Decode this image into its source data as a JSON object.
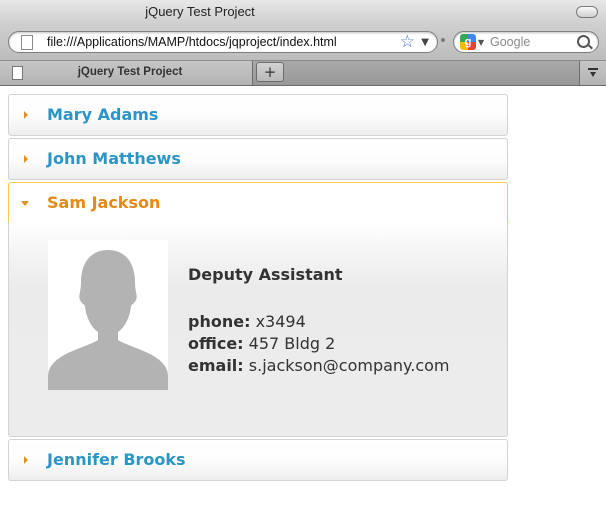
{
  "window": {
    "title": "jQuery Test Project"
  },
  "toolbar": {
    "url": "file:///Applications/MAMP/htdocs/jqproject/index.html",
    "search_placeholder": "Google"
  },
  "tabs": [
    {
      "title": "jQuery Test Project"
    }
  ],
  "new_tab_label": "+",
  "accordion": {
    "items": [
      {
        "name": "Mary Adams",
        "expanded": false
      },
      {
        "name": "John Matthews",
        "expanded": false
      },
      {
        "name": "Sam Jackson",
        "expanded": true
      },
      {
        "name": "Jennifer Brooks",
        "expanded": false
      }
    ],
    "active_detail": {
      "title": "Deputy Assistant",
      "phone_label": "phone:",
      "phone": "x3494",
      "office_label": "office:",
      "office": "457 Bldg 2",
      "email_label": "email:",
      "email": "s.jackson@company.com"
    }
  },
  "colors": {
    "link": "#2b95c6",
    "active": "#e58a15",
    "arrow": "#e09020",
    "active_border": "#fbcb4d"
  },
  "icons": [
    "page-icon",
    "bookmark-star-icon",
    "google-engine-icon",
    "search-icon",
    "tab-menu-icon"
  ]
}
